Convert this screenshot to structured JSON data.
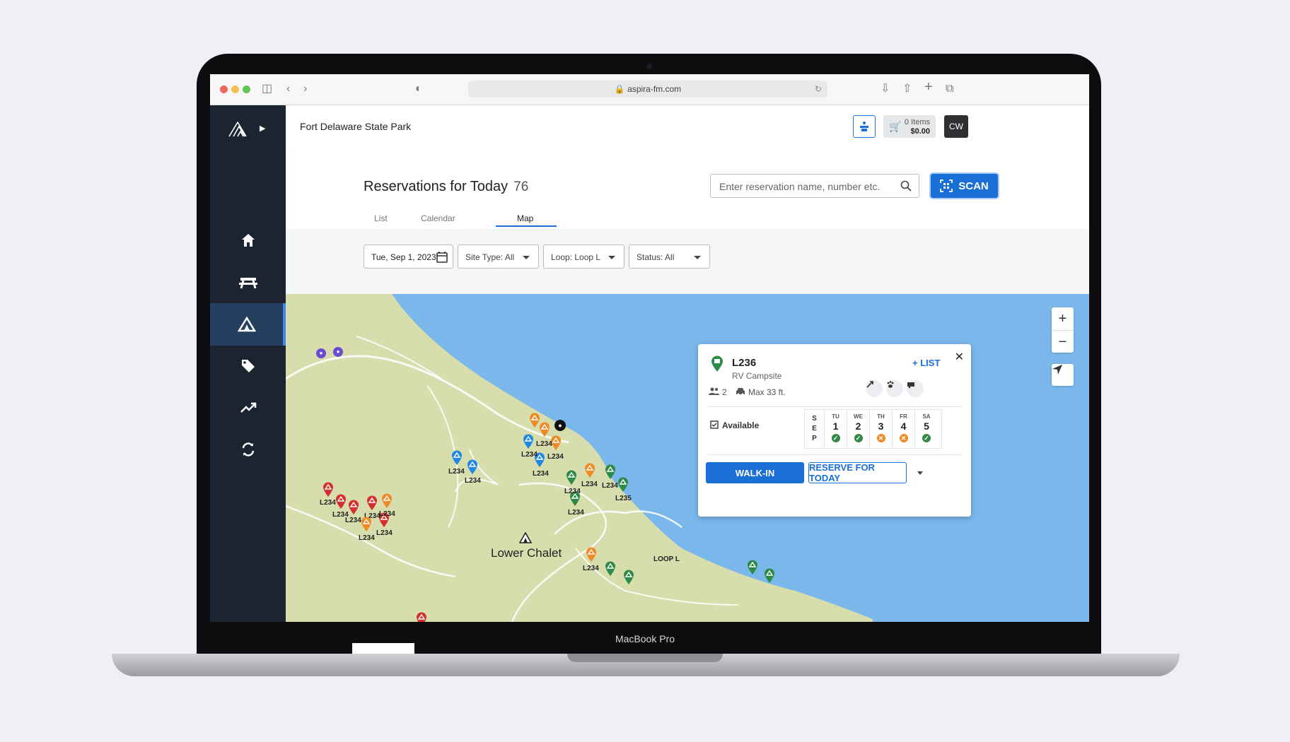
{
  "device": {
    "label": "MacBook Pro"
  },
  "browser": {
    "url": "aspira-fm.com"
  },
  "header": {
    "park_name": "Fort Delaware State Park",
    "cart_items": "0 Items",
    "cart_total": "$0.00",
    "avatar_initials": "CW"
  },
  "page": {
    "title": "Reservations for Today",
    "count": "76"
  },
  "search": {
    "placeholder": "Enter reservation name, number etc."
  },
  "scan": {
    "label": "SCAN"
  },
  "tabs": [
    {
      "label": "List"
    },
    {
      "label": "Calendar"
    },
    {
      "label": "Map"
    }
  ],
  "filters": {
    "date": "Tue, Sep 1, 2023",
    "site_type": "Site Type: All",
    "loop": "Loop: Loop L",
    "status": "Status: All"
  },
  "map": {
    "place_label": "Lower Chalet",
    "loop_label": "LOOP L",
    "pin_labels": {
      "red": [
        "L234",
        "L234",
        "L234",
        "L234",
        "L234"
      ],
      "orange_left": [
        "L234",
        "L234"
      ],
      "blue": [
        "L234",
        "L234",
        "L234",
        "L234",
        "L234"
      ],
      "orange_center": [
        "L234",
        "L234",
        "L234",
        "L234"
      ],
      "green": [
        "L234",
        "L234",
        "L234",
        "L235"
      ]
    },
    "colors": {
      "water": "#7ab8ec",
      "land": "#d8ddad",
      "red": "#d32f2f",
      "orange": "#f08a24",
      "blue": "#1e88e5",
      "green": "#2e8b47"
    }
  },
  "popup": {
    "site_id": "L236",
    "site_type": "RV Campsite",
    "add_list": "LIST",
    "occupancy": "2",
    "max_length": "Max 33 ft.",
    "status_label": "Available",
    "month": [
      "S",
      "E",
      "P"
    ],
    "days": [
      {
        "dow": "TU",
        "num": "1",
        "status": "available"
      },
      {
        "dow": "WE",
        "num": "2",
        "status": "available"
      },
      {
        "dow": "TH",
        "num": "3",
        "status": "unavailable"
      },
      {
        "dow": "FR",
        "num": "4",
        "status": "unavailable"
      },
      {
        "dow": "SA",
        "num": "5",
        "status": "available"
      }
    ],
    "walk_in": "WALK-IN",
    "reserve": "RESERVE FOR TODAY"
  }
}
